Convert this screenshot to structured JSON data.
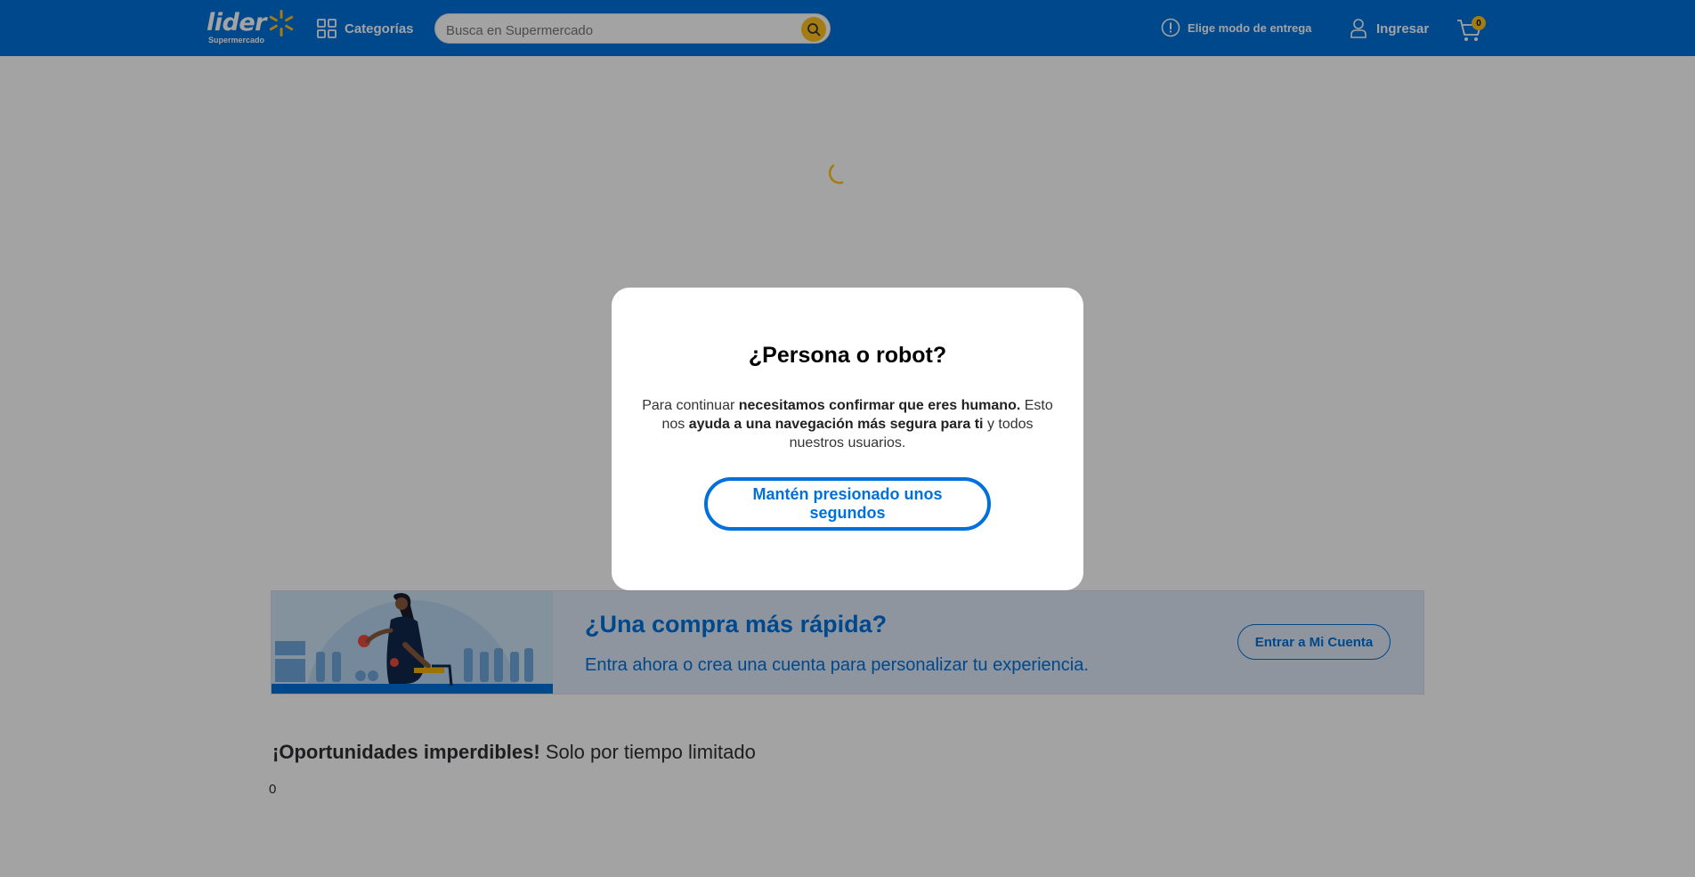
{
  "header": {
    "logo_text": "lider",
    "logo_sub": "Supermercado",
    "categories_label": "Categorías",
    "search_placeholder": "Busca en Supermercado",
    "delivery_label": "Elige modo de entrega",
    "login_label": "Ingresar",
    "cart_count": "0",
    "brand_color": "#0071dc",
    "accent_color": "#ffc220"
  },
  "promo": {
    "title": "¿Una compra más rápida?",
    "subtitle": "Entra ahora o crea una cuenta para personalizar tu experiencia.",
    "button_label": "Entrar a Mi Cuenta"
  },
  "deals": {
    "title_bold": "¡Oportunidades imperdibles!",
    "title_light": "Solo por tiempo limitado",
    "count_text": "0"
  },
  "modal": {
    "title": "¿Persona o robot?",
    "text_part1": "Para continuar ",
    "text_bold1": "necesitamos confirmar que eres humano.",
    "text_part2": " Esto nos ",
    "text_bold2": "ayuda a una navegación más segura para ti",
    "text_part3": " y todos nuestros usuarios.",
    "button_label": "Mantén presionado unos segundos"
  }
}
